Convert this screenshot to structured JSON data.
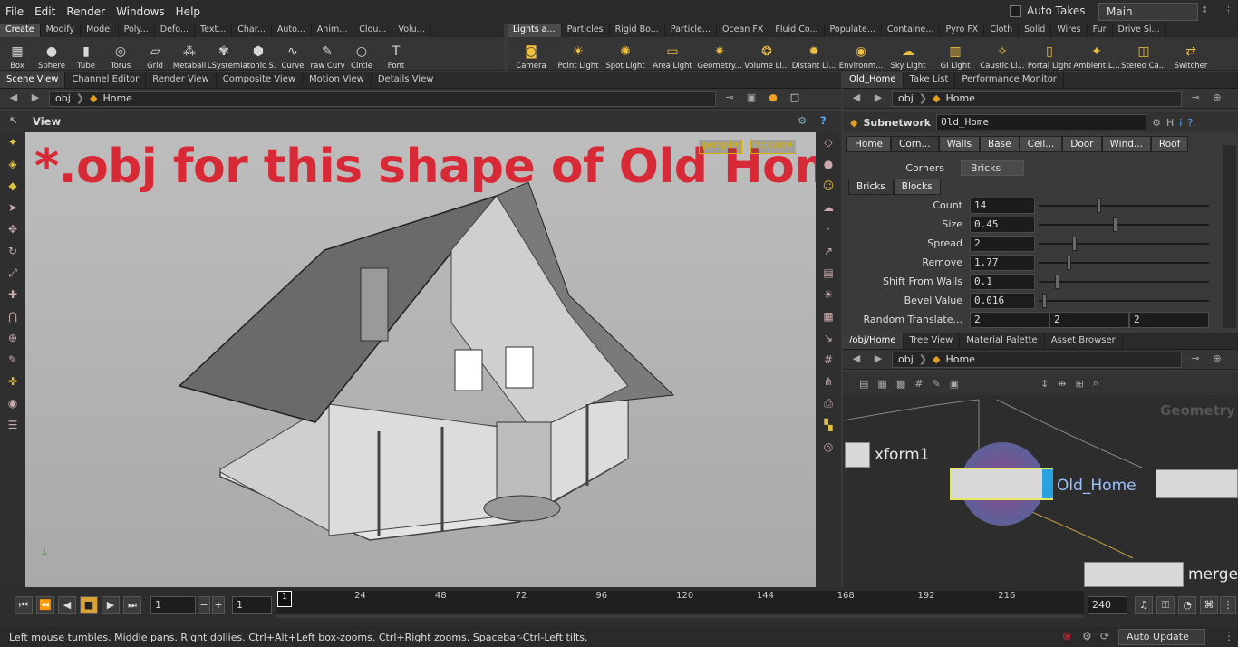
{
  "menu": [
    "File",
    "Edit",
    "Render",
    "Windows",
    "Help"
  ],
  "header": {
    "auto_takes": "Auto Takes",
    "desktop": "Main"
  },
  "shelf_left": {
    "tabs": [
      "Create",
      "Modify",
      "Model",
      "Poly...",
      "Defo...",
      "Text...",
      "Char...",
      "Auto...",
      "Anim...",
      "Clou...",
      "Volu..."
    ],
    "tools": [
      {
        "label": "Box",
        "icon": "box-icon"
      },
      {
        "label": "Sphere",
        "icon": "sphere-icon"
      },
      {
        "label": "Tube",
        "icon": "tube-icon"
      },
      {
        "label": "Torus",
        "icon": "torus-icon"
      },
      {
        "label": "Grid",
        "icon": "grid-icon"
      },
      {
        "label": "Metaball",
        "icon": "metaball-icon"
      },
      {
        "label": "LSystem",
        "icon": "lsystem-icon"
      },
      {
        "label": "Platonic S...",
        "icon": "platonic-icon"
      },
      {
        "label": "Curve",
        "icon": "curve-icon"
      },
      {
        "label": "Draw Curve",
        "icon": "draw-curve-icon"
      },
      {
        "label": "Circle",
        "icon": "circle-icon"
      },
      {
        "label": "Font",
        "icon": "font-icon"
      }
    ]
  },
  "shelf_right": {
    "tabs": [
      "Lights a...",
      "Particles",
      "Rigid Bo...",
      "Particle...",
      "Ocean FX",
      "Fluid Co...",
      "Populate...",
      "Containe...",
      "Pyro FX",
      "Cloth",
      "Solid",
      "Wires",
      "Fur",
      "Drive Si..."
    ],
    "tools": [
      {
        "label": "Camera",
        "icon": "camera-icon"
      },
      {
        "label": "Point Light",
        "icon": "point-light-icon"
      },
      {
        "label": "Spot Light",
        "icon": "spot-light-icon"
      },
      {
        "label": "Area Light",
        "icon": "area-light-icon"
      },
      {
        "label": "Geometry...",
        "icon": "geometry-light-icon"
      },
      {
        "label": "Volume Li...",
        "icon": "volume-light-icon"
      },
      {
        "label": "Distant Li...",
        "icon": "distant-light-icon"
      },
      {
        "label": "Environm...",
        "icon": "environment-light-icon"
      },
      {
        "label": "Sky Light",
        "icon": "sky-light-icon"
      },
      {
        "label": "GI Light",
        "icon": "gi-light-icon"
      },
      {
        "label": "Caustic Li...",
        "icon": "caustic-light-icon"
      },
      {
        "label": "Portal Light",
        "icon": "portal-light-icon"
      },
      {
        "label": "Ambient L...",
        "icon": "ambient-light-icon"
      },
      {
        "label": "Stereo Ca...",
        "icon": "stereo-camera-icon"
      },
      {
        "label": "Switcher",
        "icon": "switcher-icon"
      }
    ]
  },
  "left_tabs": [
    "Scene View",
    "Channel Editor",
    "Render View",
    "Composite View",
    "Motion View",
    "Details View"
  ],
  "path": {
    "root": "obj",
    "node": "Home"
  },
  "view_title": "View",
  "viewport": {
    "overlay": "*.obj for this shape of Old Home",
    "camera": "persp1",
    "cam_badge": "no cam"
  },
  "timeline": {
    "frame": "1",
    "start": "1",
    "end": "240",
    "current": "1",
    "ticks": [
      "1",
      "24",
      "48",
      "72",
      "96",
      "120",
      "144",
      "168",
      "192",
      "216"
    ]
  },
  "status": "Left mouse tumbles. Middle pans. Right dollies. Ctrl+Alt+Left box-zooms. Ctrl+Right zooms. Spacebar-Ctrl-Left tilts.",
  "auto_update": "Auto Update",
  "right_tabs": [
    "Old_Home",
    "Take List",
    "Performance Monitor"
  ],
  "params": {
    "type": "Subnetwork",
    "name": "Old_Home",
    "folders": [
      "Home",
      "Corn...",
      "Walls",
      "Base",
      "Ceil...",
      "Door",
      "Wind...",
      "Roof"
    ],
    "corners_label": "Corners",
    "corners_value": "Bricks",
    "subtabs": [
      "Bricks",
      "Blocks"
    ],
    "rows": [
      {
        "label": "Count",
        "value": "14",
        "frac": 0.35
      },
      {
        "label": "Size",
        "value": "0.45",
        "frac": 0.45
      },
      {
        "label": "Spread",
        "value": "2",
        "frac": 0.2
      },
      {
        "label": "Remove",
        "value": "1.77",
        "frac": 0.17
      },
      {
        "label": "Shift From Walls",
        "value": "0.1",
        "frac": 0.1
      },
      {
        "label": "Bevel Value",
        "value": "0.016",
        "frac": 0.02
      }
    ],
    "random_label": "Random Translate...",
    "random_values": [
      "2",
      "2",
      "2"
    ]
  },
  "net_tabs": [
    "/obj/Home",
    "Tree View",
    "Material Palette",
    "Asset Browser"
  ],
  "network": {
    "context": "Geometry",
    "nodes": [
      "xform1",
      "Old_Home",
      "merge"
    ]
  }
}
